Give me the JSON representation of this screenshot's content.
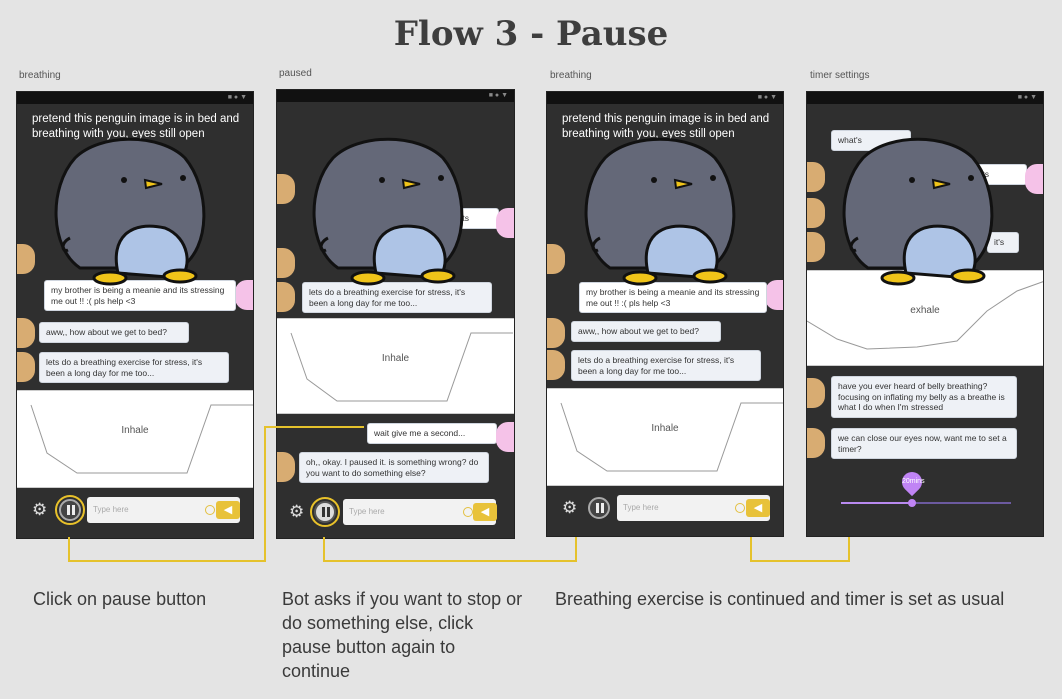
{
  "title": "Flow 3 - Pause",
  "labels": {
    "s1": "breathing",
    "s2": "paused",
    "s3": "breathing",
    "s4": "timer settings"
  },
  "common": {
    "note": "pretend this penguin image is in bed and breathing with you, eyes still open",
    "msg_stress": "my brother is being a meanie and its stressing me out !! :( pls help <3",
    "msg_bed": "aww,, how about we get to bed?",
    "msg_exercise": "lets do a breathing exercise for stress, it's been a long day for me too...",
    "inhale": "Inhale",
    "exhale": "exhale",
    "input_placeholder": "Type here",
    "send_icon": "◀"
  },
  "screen2": {
    "frag_top": "and its",
    "frag_stress": "lets do a breathing exercise for stress, it's been a long day for me too...",
    "msg_wait": "wait give me a second...",
    "msg_bot": "oh,, okay. I paused it. is something wrong? do you want to do something else?"
  },
  "screen4": {
    "frag_whats": "what's",
    "frag_andits": "and its",
    "frag_its": "it's",
    "msg_belly": "have you ever heard of belly breathing? focusing on inflating my belly as a breathe is what I do when I'm stressed",
    "msg_close": "we can close our eyes now, want me to set a timer?",
    "slider_label": "20mins",
    "slider_value": 0.42
  },
  "status_icons": "■ ● ▼",
  "captions": {
    "c1": "Click on pause button",
    "c2": "Bot asks if you want to stop or do something else, click pause button again to continue",
    "c3": "Breathing exercise is continued and timer is set as usual"
  }
}
